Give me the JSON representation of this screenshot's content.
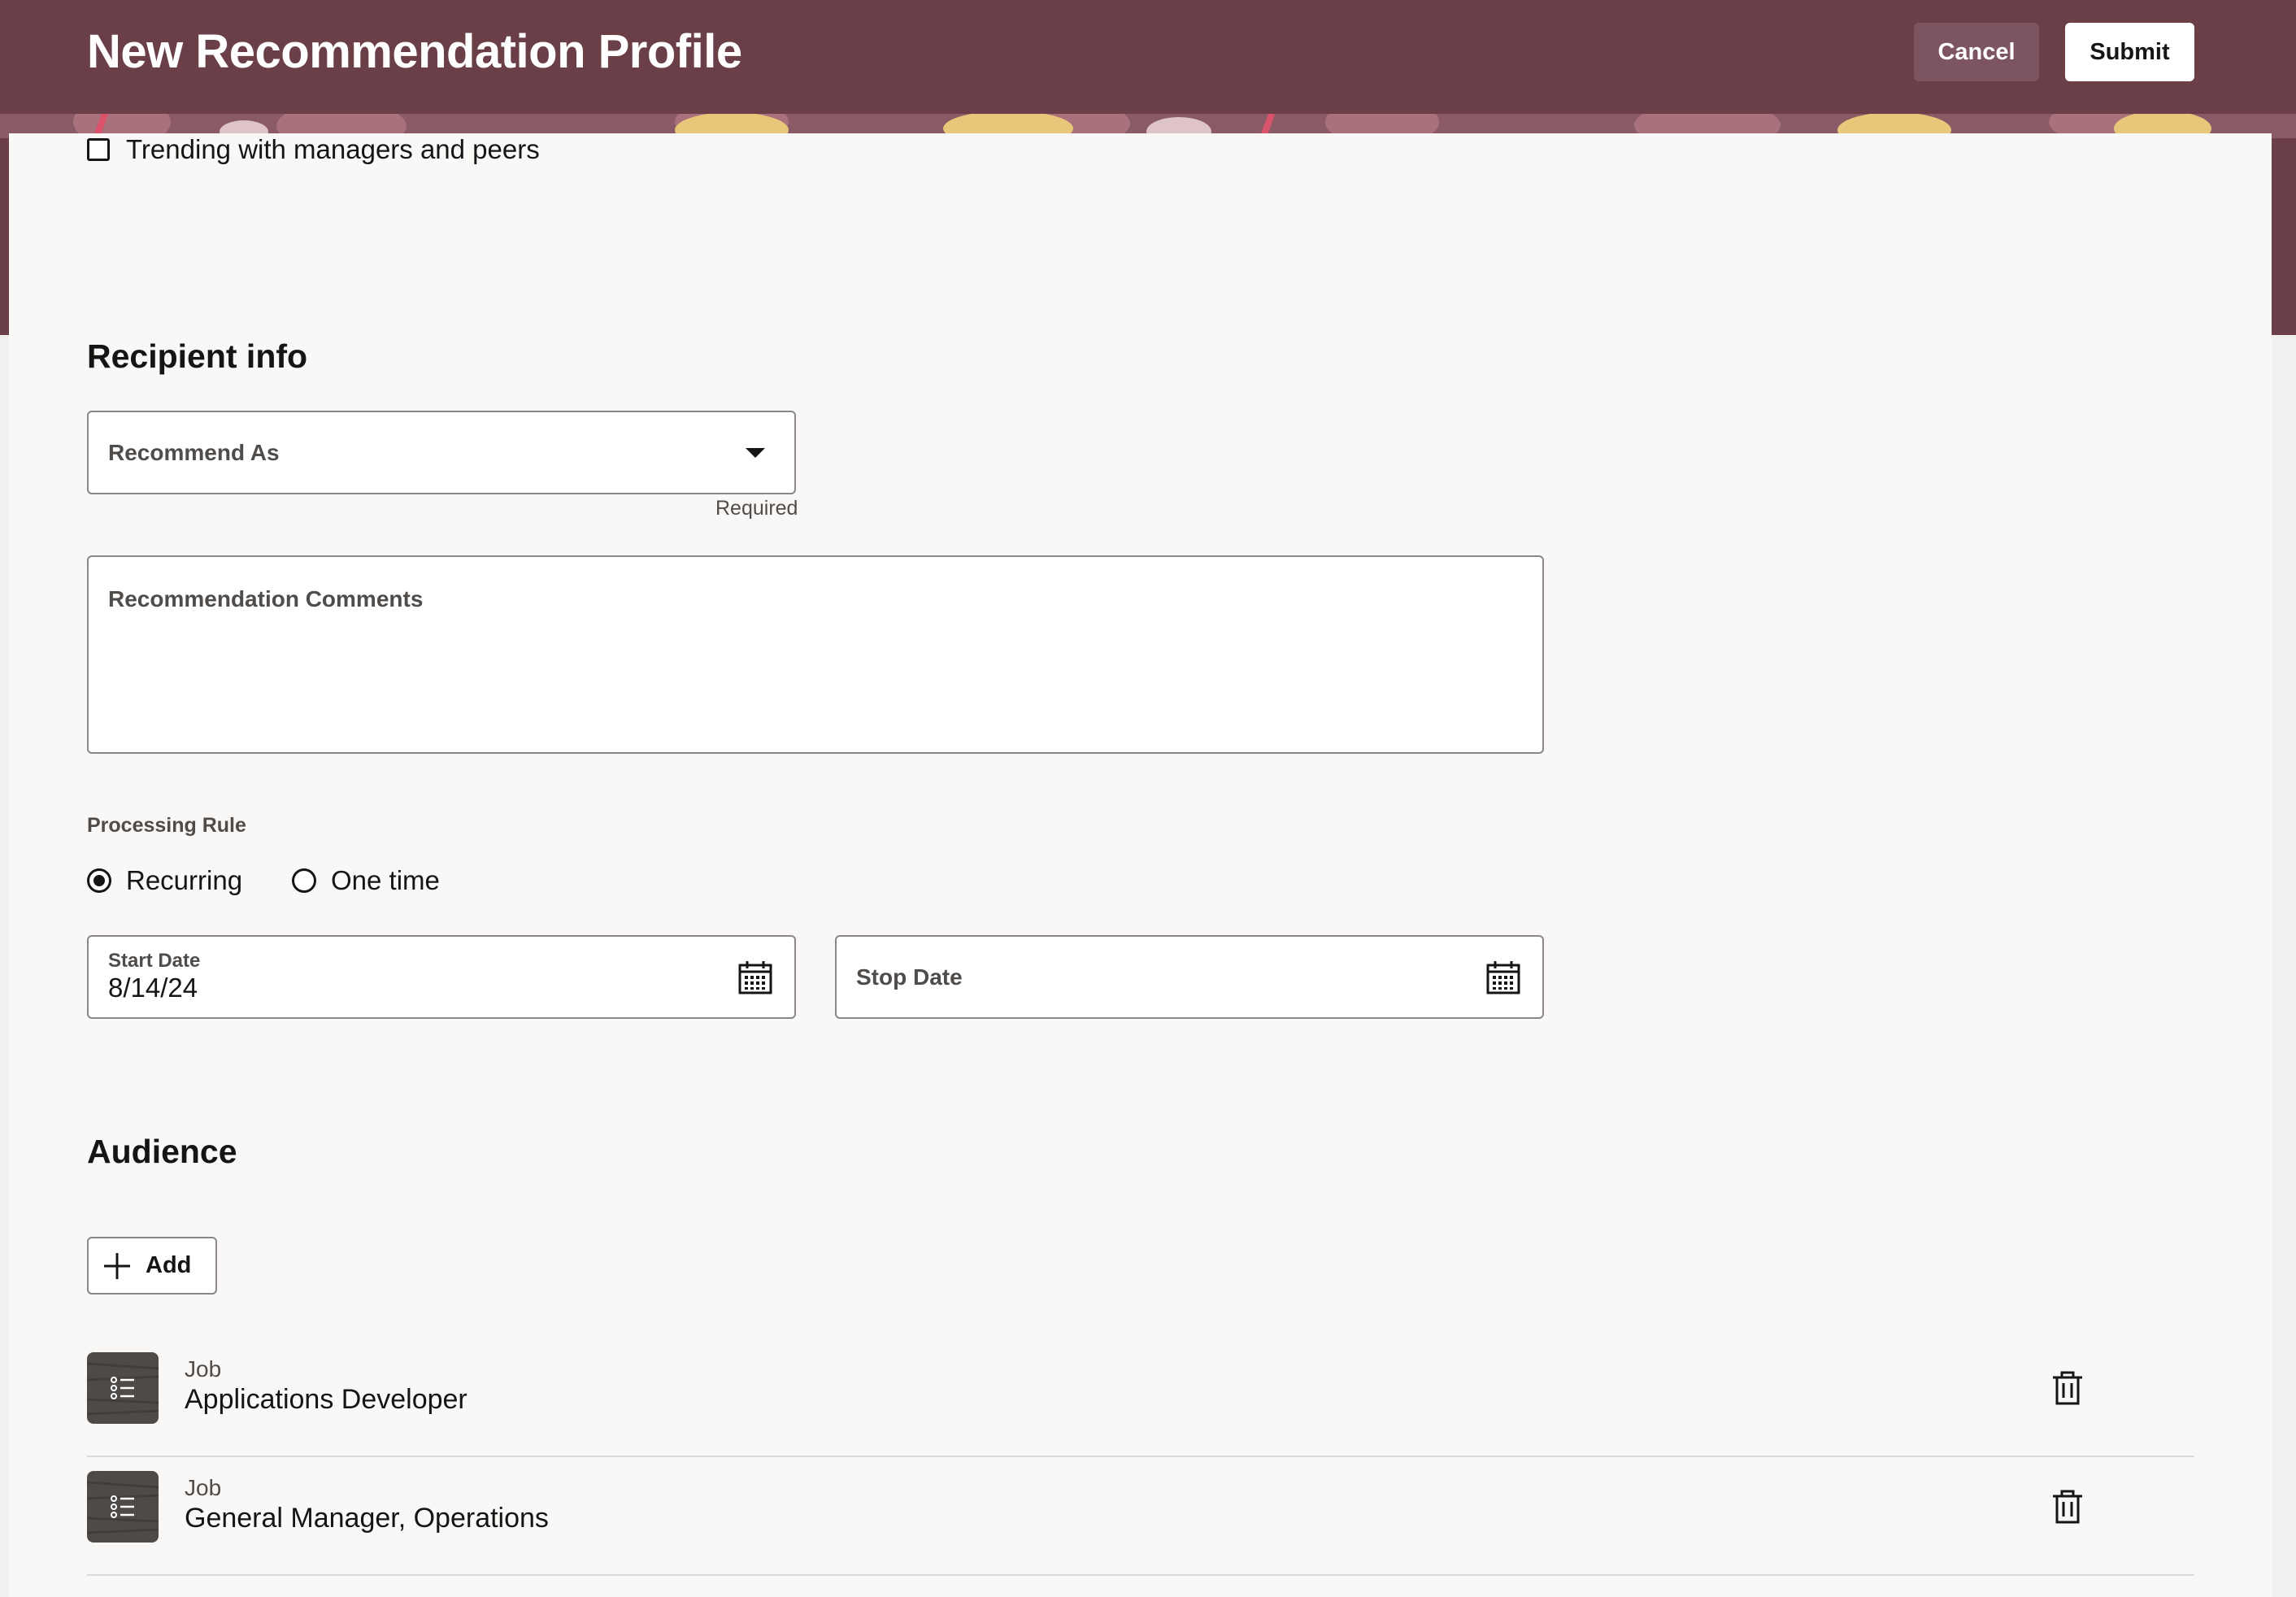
{
  "header": {
    "title": "New Recommendation Profile",
    "cancel_label": "Cancel",
    "submit_label": "Submit"
  },
  "top_checkbox": {
    "label": "Trending with managers and peers",
    "checked": false
  },
  "recipient_info": {
    "title": "Recipient info",
    "recommend_as": {
      "label": "Recommend As",
      "value": "",
      "helper": "Required"
    },
    "comments": {
      "label": "Recommendation Comments",
      "value": ""
    },
    "processing_rule": {
      "label": "Processing Rule",
      "options": [
        {
          "label": "Recurring",
          "selected": true
        },
        {
          "label": "One time",
          "selected": false
        }
      ]
    },
    "start_date": {
      "label": "Start Date",
      "value": "8/14/24"
    },
    "stop_date": {
      "label": "Stop Date",
      "value": ""
    }
  },
  "audience": {
    "title": "Audience",
    "add_label": "Add",
    "items": [
      {
        "type": "Job",
        "name": "Applications Developer"
      },
      {
        "type": "Job",
        "name": "General Manager, Operations"
      }
    ]
  },
  "colors": {
    "banner": "#6a3f48",
    "cancel_bg": "#7c5560",
    "card_bg": "#f9f8f6",
    "text": "#161513",
    "muted_text": "#4f4c4a",
    "border": "#8a8786"
  },
  "icons": [
    "calendar-icon",
    "chevron-down-icon",
    "plus-icon",
    "list-icon",
    "trash-icon"
  ]
}
